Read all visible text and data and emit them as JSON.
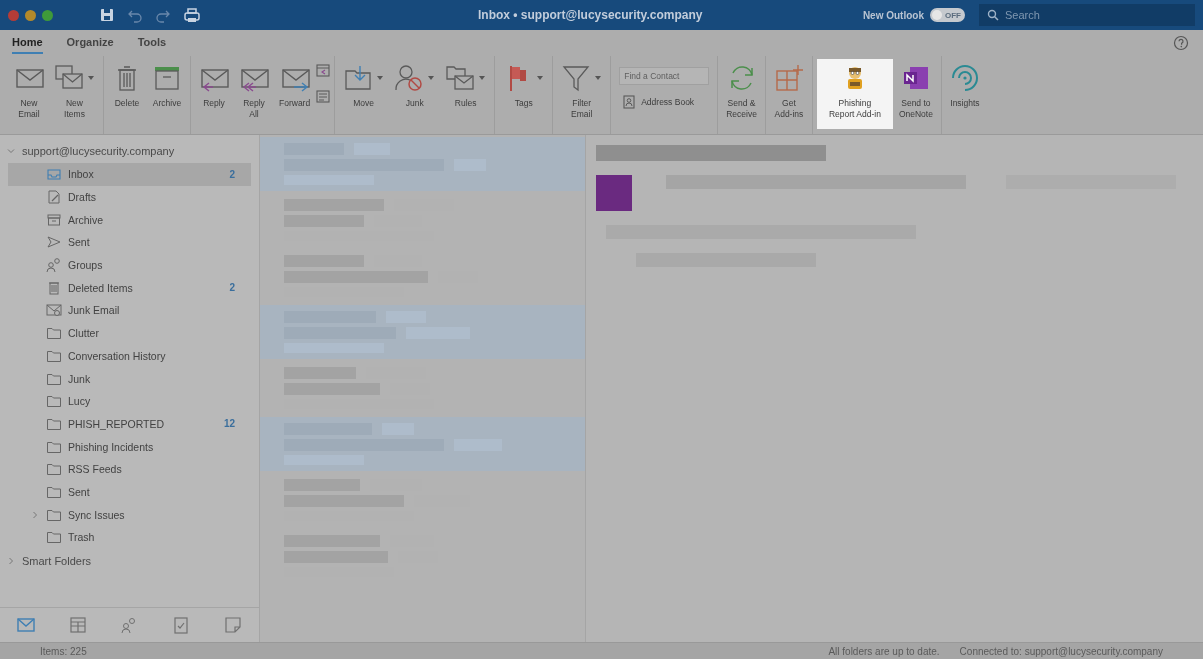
{
  "window": {
    "title": "Inbox • support@lucysecurity.company",
    "new_outlook": {
      "label": "New Outlook",
      "toggle_text": "OFF",
      "on": false
    },
    "search": {
      "placeholder": "Search"
    }
  },
  "ribbon": {
    "tabs": [
      {
        "label": "Home",
        "selected": true
      },
      {
        "label": "Organize",
        "selected": false
      },
      {
        "label": "Tools",
        "selected": false
      }
    ],
    "groups": [
      {
        "items": [
          {
            "kind": "large",
            "label": "New\nEmail",
            "highlighted": false
          },
          {
            "kind": "dropdown",
            "label": "New\nItems",
            "highlighted": false
          }
        ]
      },
      {
        "items": [
          {
            "kind": "large",
            "label": "Delete",
            "highlighted": false
          },
          {
            "kind": "large",
            "label": "Archive",
            "highlighted": false
          }
        ]
      },
      {
        "items": [
          {
            "kind": "large",
            "label": "Reply",
            "highlighted": false
          },
          {
            "kind": "large",
            "label": "Reply\nAll",
            "highlighted": false
          },
          {
            "kind": "large",
            "label": "Forward",
            "highlighted": false
          },
          {
            "kind": "stack",
            "highlighted": false
          }
        ]
      },
      {
        "items": [
          {
            "kind": "dropdown",
            "label": "Move",
            "highlighted": false
          },
          {
            "kind": "dropdown",
            "label": "Junk",
            "highlighted": false
          },
          {
            "kind": "dropdown",
            "label": "Rules",
            "highlighted": false
          }
        ]
      },
      {
        "items": [
          {
            "kind": "dropdown",
            "label": "Tags",
            "highlighted": false
          }
        ]
      },
      {
        "items": [
          {
            "kind": "dropdown",
            "label": "Filter\nEmail",
            "highlighted": false
          }
        ]
      },
      {
        "items": [
          {
            "kind": "contact",
            "placeholder": "Find a Contact",
            "label": "Address Book",
            "highlighted": false
          }
        ]
      },
      {
        "items": [
          {
            "kind": "large",
            "label": "Send &\nReceive",
            "highlighted": false
          }
        ]
      },
      {
        "items": [
          {
            "kind": "large",
            "label": "Get\nAdd-ins",
            "highlighted": false
          }
        ]
      },
      {
        "items": [
          {
            "kind": "large",
            "label": "Phishing\nReport Add-in",
            "highlighted": true
          },
          {
            "kind": "large",
            "label": "Send to\nOneNote",
            "highlighted": false
          }
        ]
      },
      {
        "items": [
          {
            "kind": "large",
            "label": "Insights",
            "highlighted": false
          }
        ]
      }
    ]
  },
  "sidebar": {
    "accounts": [
      {
        "label": "support@lucysecurity.company",
        "expanded": true,
        "children": [
          {
            "label": "Inbox",
            "count": "2",
            "selected": true
          },
          {
            "label": "Drafts",
            "selected": false
          },
          {
            "label": "Archive",
            "selected": false
          },
          {
            "label": "Sent",
            "selected": false
          },
          {
            "label": "Groups",
            "selected": false
          },
          {
            "label": "Deleted Items",
            "count": "2",
            "selected": false
          },
          {
            "label": "Junk Email",
            "selected": false
          },
          {
            "label": "Clutter",
            "selected": false
          },
          {
            "label": "Conversation History",
            "selected": false
          },
          {
            "label": "Junk",
            "selected": false
          },
          {
            "label": "Lucy",
            "selected": false
          },
          {
            "label": "PHISH_REPORTED",
            "count": "12",
            "selected": false
          },
          {
            "label": "Phishing Incidents",
            "selected": false
          },
          {
            "label": "RSS Feeds",
            "selected": false
          },
          {
            "label": "Sent",
            "selected": false
          },
          {
            "label": "Sync Issues",
            "expanded": false,
            "selected": false
          },
          {
            "label": "Trash",
            "selected": false
          }
        ]
      },
      {
        "label": "Smart Folders",
        "expanded": false
      }
    ],
    "nav": [
      {
        "selected": true
      },
      {
        "selected": false
      },
      {
        "selected": false
      },
      {
        "selected": false
      },
      {
        "selected": false
      }
    ]
  },
  "status_bar": {
    "items": "Items: 225",
    "sync": "All folders are up to date.",
    "connection": "Connected to: support@lucysecurity.company"
  }
}
